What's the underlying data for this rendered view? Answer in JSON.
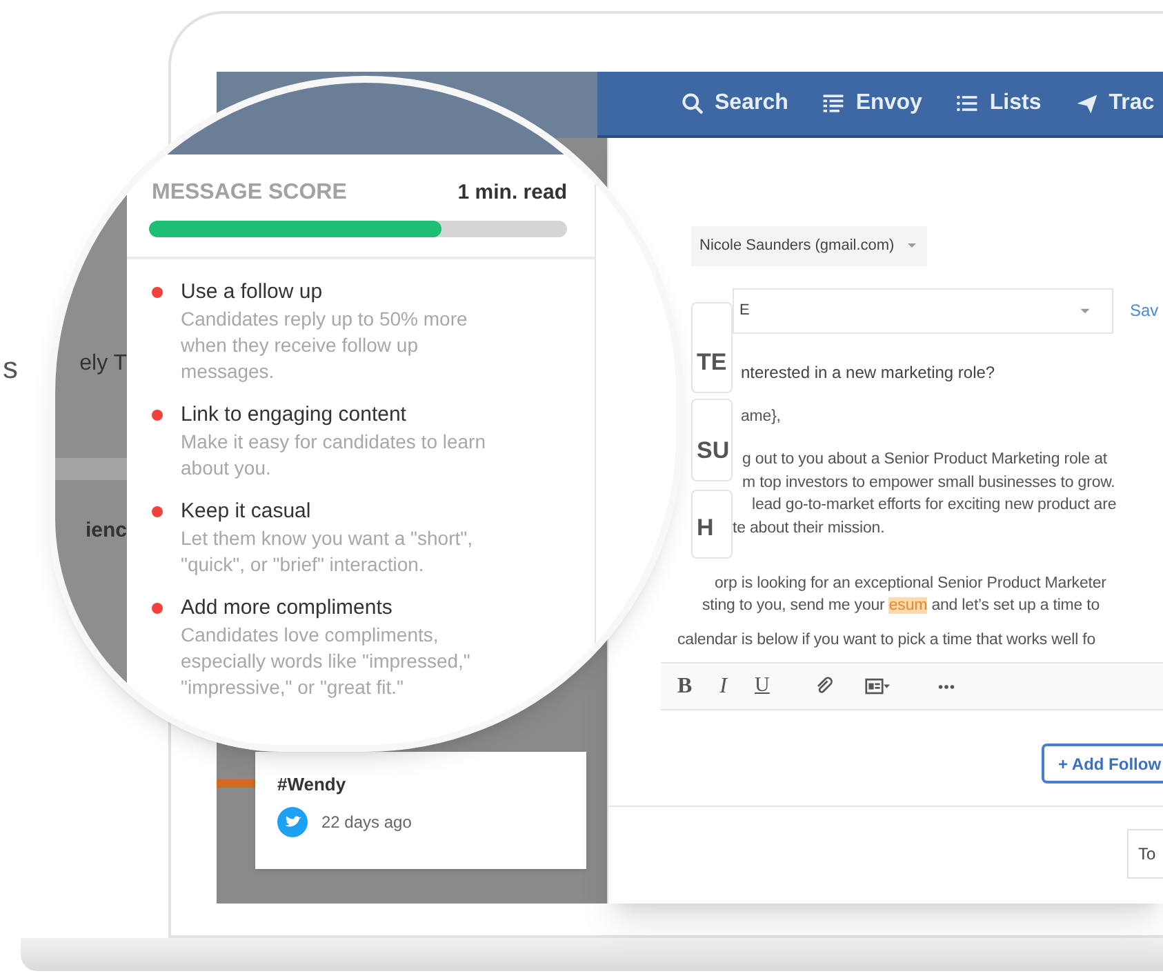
{
  "page_side_text": "s",
  "nav": [
    {
      "kind": "search",
      "label": "Search"
    },
    {
      "kind": "envoy",
      "label": "Envoy"
    },
    {
      "kind": "lists",
      "label": "Lists"
    },
    {
      "kind": "track",
      "label": "Trac"
    }
  ],
  "background_pane": {
    "snippets": [
      "ely T",
      "ienc"
    ],
    "card": {
      "title": "#Wendy",
      "time": "22 days ago"
    }
  },
  "score_panel": {
    "title": "MESSAGE SCORE",
    "read_time": "1 min. read",
    "level": 0.7,
    "tips": [
      {
        "title": "Use a follow up",
        "text": "Candidates reply up to 50% more when they receive follow up messages."
      },
      {
        "title": "Link to engaging content",
        "text": "Make it easy for candidates to learn about you."
      },
      {
        "title": "Keep it casual",
        "text": "Let them know you want a \"short\", \"quick\", or \"brief\" interaction."
      },
      {
        "title": "Add more compliments",
        "text": "Candidates love compliments, especially words like \"impressed,\" \"impressive,\" or \"great fit.\""
      }
    ]
  },
  "composer": {
    "sender": "Nicole Saunders (gmail.com)",
    "template_value": "E",
    "save_link": "Sav",
    "labels": [
      "TE",
      "SU",
      "H"
    ],
    "subject": "nterested in a new marketing role?",
    "body": [
      [
        {
          "text": "ame},",
          "highlighted": false
        }
      ],
      [
        {
          "text": "g out to you about a Senior Product Marketing role at",
          "highlighted": false
        }
      ],
      [
        {
          "text": "m top investors to empower small businesses to grow.",
          "highlighted": false
        }
      ],
      [
        {
          "text": "lead go-to-market efforts for exciting new product are",
          "highlighted": false
        }
      ],
      [
        {
          "text": "te about their mission.",
          "highlighted": false
        }
      ],
      [
        {
          "text": "orp is looking for an exceptional Senior Product Marketer",
          "highlighted": false
        }
      ],
      [
        {
          "text": "sting to you, send me your ",
          "highlighted": false
        },
        {
          "text": "esum",
          "highlighted": true
        },
        {
          "text": " and let’s set up a time to",
          "highlighted": false
        }
      ],
      [
        {
          "text": "calendar is below if you want to pick a time that works well fo",
          "highlighted": false
        }
      ]
    ],
    "toolbar": [
      {
        "kind": "bold",
        "label": "B"
      },
      {
        "kind": "italic",
        "label": "I"
      },
      {
        "kind": "underline",
        "label": "U"
      },
      {
        "kind": "attach"
      },
      {
        "kind": "card"
      },
      {
        "kind": "more"
      }
    ],
    "add_button": "+ Add Follow",
    "footer_button": "To"
  }
}
